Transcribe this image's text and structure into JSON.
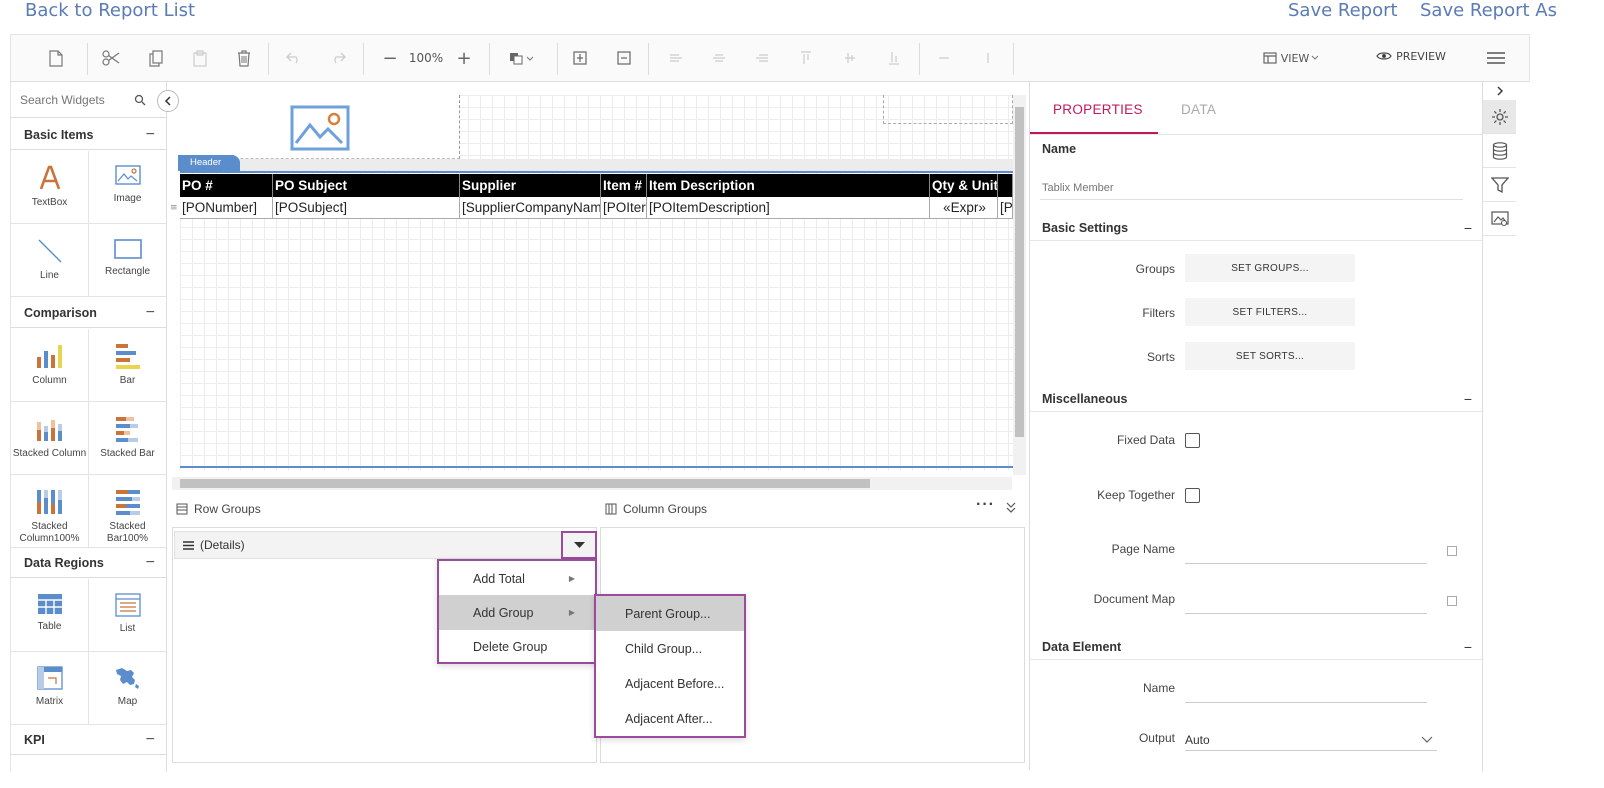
{
  "top_links": {
    "back": "Back to Report List",
    "save": "Save Report",
    "save_as": "Save Report As"
  },
  "toolbar": {
    "zoom": "100%",
    "view_label": "VIEW",
    "preview_label": "PREVIEW"
  },
  "widgets": {
    "search_placeholder": "Search Widgets",
    "categories": {
      "basic": "Basic Items",
      "comparison": "Comparison",
      "data_regions": "Data Regions",
      "kpi": "KPI"
    },
    "items": {
      "textbox": "TextBox",
      "image": "Image",
      "line": "Line",
      "rectangle": "Rectangle",
      "column": "Column",
      "bar": "Bar",
      "stacked_column": "Stacked Column",
      "stacked_bar": "Stacked Bar",
      "stacked_column100": "Stacked Column100%",
      "stacked_bar100": "Stacked Bar100%",
      "table": "Table",
      "list": "List",
      "matrix": "Matrix",
      "map": "Map"
    }
  },
  "canvas": {
    "header_tab": "Header",
    "columns": [
      {
        "header": "PO #",
        "cell": "[PONumber]"
      },
      {
        "header": "PO Subject",
        "cell": "[POSubject]"
      },
      {
        "header": "Supplier",
        "cell": "[SupplierCompanyNam"
      },
      {
        "header": "Item #",
        "cell": "[POIter"
      },
      {
        "header": "Item Description",
        "cell": "[POItemDescription]"
      },
      {
        "header": "Qty & Unit",
        "cell": "«Expr»"
      },
      {
        "header": "",
        "cell": "[P"
      }
    ]
  },
  "groups": {
    "row_groups": "Row Groups",
    "column_groups": "Column Groups",
    "details": "(Details)",
    "menu": {
      "add_total": "Add Total",
      "add_group": "Add Group",
      "delete_group": "Delete Group"
    },
    "submenu": {
      "parent": "Parent Group...",
      "child": "Child Group...",
      "adjacent_before": "Adjacent Before...",
      "adjacent_after": "Adjacent After..."
    }
  },
  "properties": {
    "tabs": {
      "properties": "PROPERTIES",
      "data": "DATA"
    },
    "name_label": "Name",
    "name_placeholder": "Tablix Member",
    "basic_settings": "Basic Settings",
    "groups_label": "Groups",
    "groups_btn": "SET GROUPS...",
    "filters_label": "Filters",
    "filters_btn": "SET FILTERS...",
    "sorts_label": "Sorts",
    "sorts_btn": "SET SORTS...",
    "misc": "Miscellaneous",
    "fixed_data": "Fixed Data",
    "keep_together": "Keep Together",
    "page_name": "Page Name",
    "document_map": "Document Map",
    "data_element": "Data Element",
    "de_name": "Name",
    "output_label": "Output",
    "output_value": "Auto"
  },
  "colors": {
    "accent": "#c2185b",
    "link": "#5a7bb5",
    "menu_border": "#9b4b9b",
    "header_tab": "#5b8dcc"
  }
}
